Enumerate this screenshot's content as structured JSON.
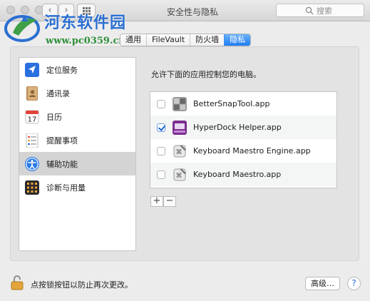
{
  "window": {
    "title": "安全性与隐私",
    "search_placeholder": "搜索"
  },
  "watermark": {
    "title": "河东软件园",
    "url": "www.pc0359.cn"
  },
  "tabs": [
    {
      "label": "通用",
      "active": false
    },
    {
      "label": "FileVault",
      "active": false
    },
    {
      "label": "防火墙",
      "active": false
    },
    {
      "label": "隐私",
      "active": true
    }
  ],
  "sidebar": {
    "items": [
      {
        "label": "定位服务",
        "icon": "location-arrow-icon",
        "selected": false
      },
      {
        "label": "通讯录",
        "icon": "contacts-book-icon",
        "selected": false
      },
      {
        "label": "日历",
        "icon": "calendar-icon",
        "day": "17",
        "selected": false
      },
      {
        "label": "提醒事项",
        "icon": "reminders-icon",
        "selected": false
      },
      {
        "label": "辅助功能",
        "icon": "accessibility-icon",
        "selected": true
      },
      {
        "label": "诊断与用量",
        "icon": "diagnostics-icon",
        "selected": false
      }
    ]
  },
  "main": {
    "instruction": "允许下面的应用控制您的电脑。",
    "apps": [
      {
        "name": "BetterSnapTool.app",
        "checked": false,
        "icon": "bettersnaptool-icon"
      },
      {
        "name": "HyperDock Helper.app",
        "checked": true,
        "icon": "hyperdock-icon"
      },
      {
        "name": "Keyboard Maestro Engine.app",
        "checked": false,
        "icon": "keyboard-maestro-icon"
      },
      {
        "name": "Keyboard Maestro.app",
        "checked": false,
        "icon": "keyboard-maestro-icon"
      }
    ],
    "add_label": "+",
    "remove_label": "−"
  },
  "footer": {
    "lock_text": "点按锁按钮以防止再次更改。",
    "advanced_label": "高级…",
    "help_label": "?"
  },
  "colors": {
    "accent": "#1f7cf4",
    "watermark_blue": "#2b6fd1",
    "watermark_green": "#2f8f3a"
  }
}
